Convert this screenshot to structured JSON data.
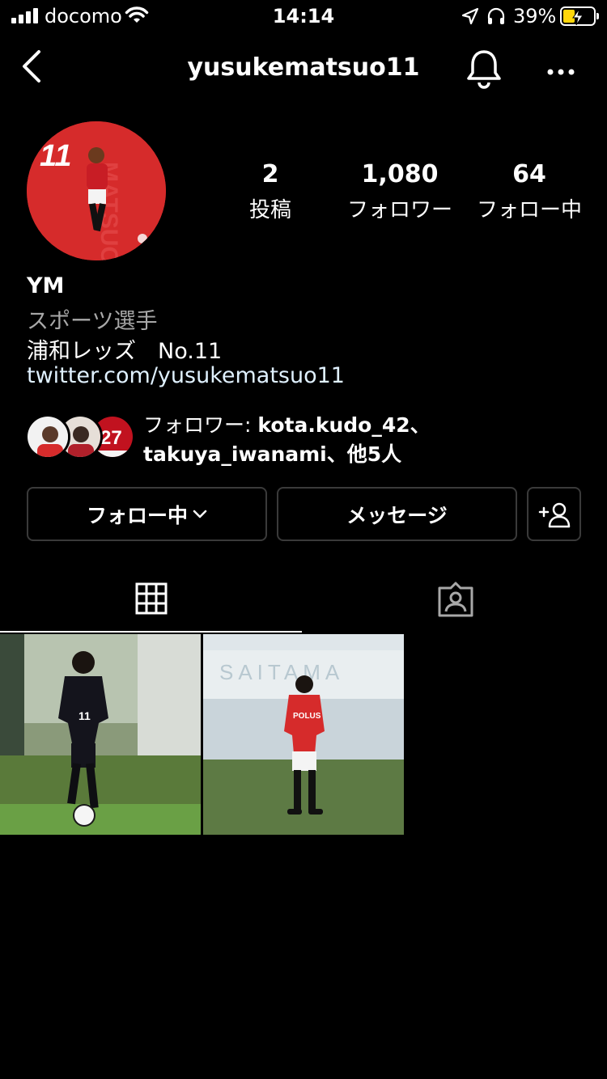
{
  "status_bar": {
    "carrier": "docomo",
    "time": "14:14",
    "battery_percent": "39%",
    "battery_level": 0.39,
    "accent_color": "#ffd60a"
  },
  "nav": {
    "username": "yusukematsuo11",
    "icons": [
      "chevron-left-icon",
      "bell-icon",
      "more-icon"
    ]
  },
  "profile": {
    "avatar_number": "11",
    "stats": [
      {
        "value": "2",
        "label": "投稿"
      },
      {
        "value": "1,080",
        "label": "フォロワー"
      },
      {
        "value": "64",
        "label": "フォロー中"
      }
    ],
    "name": "YM",
    "category": "スポーツ選手",
    "description": "浦和レッズ　No.11",
    "link": "twitter.com/yusukematsuo11"
  },
  "followed_by": {
    "prefix": "フォロワー: ",
    "user1": "kota.kudo_42",
    "sep": "、",
    "user2": "takuya_iwanami",
    "suffix": "、他5人",
    "avatar_text": "27"
  },
  "buttons": {
    "following": "フォロー中",
    "message": "メッセージ"
  },
  "tabs": {
    "active": "grid",
    "items": [
      "grid-icon",
      "tagged-icon"
    ]
  },
  "posts": {
    "jersey_number": "11",
    "stadium_text": "SAITAMA",
    "sponsor": "POLUS"
  },
  "colors": {
    "background": "#000000",
    "button_border": "#3a3a3a",
    "secondary_text": "#a8a8a8",
    "link_text": "#e0f1ff",
    "team_red": "#d62b2b"
  }
}
